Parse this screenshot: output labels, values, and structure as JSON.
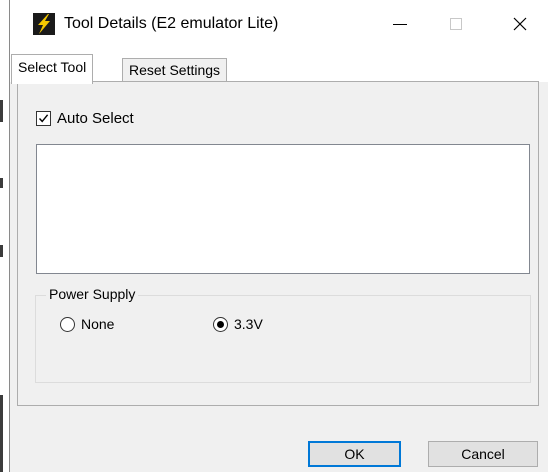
{
  "window": {
    "title": "Tool Details (E2 emulator Lite)",
    "controls": {
      "minimize_icon": "minimize-icon",
      "maximize_icon": "maximize-icon",
      "close_icon": "close-icon"
    },
    "app_icon": "lightning-icon"
  },
  "tabs": [
    {
      "label": "Select Tool",
      "active": true
    },
    {
      "label": "Reset Settings",
      "active": false
    }
  ],
  "select_tool": {
    "auto_select": {
      "label": "Auto Select",
      "checked": true
    },
    "tool_list": {
      "items": []
    },
    "power_supply": {
      "title": "Power Supply",
      "options": [
        {
          "label": "None",
          "selected": false
        },
        {
          "label": "3.3V",
          "selected": true
        }
      ]
    }
  },
  "buttons": {
    "ok_label": "OK",
    "cancel_label": "Cancel"
  },
  "colors": {
    "focus_border": "#0078d7",
    "window_bg": "#f0f0f0",
    "icon_yellow": "#f5c800"
  }
}
